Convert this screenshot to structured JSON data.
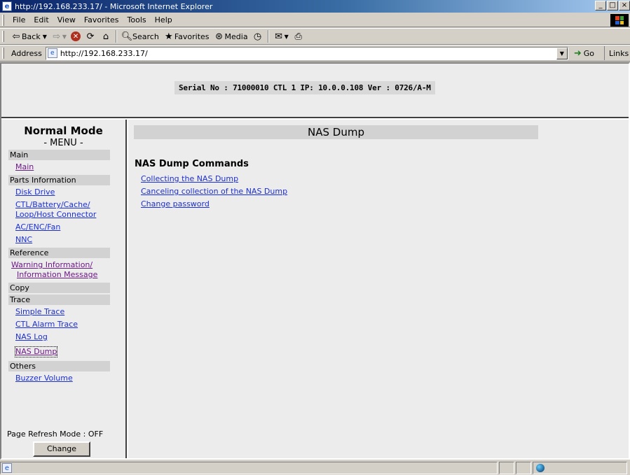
{
  "window": {
    "title": "http://192.168.233.17/ - Microsoft Internet Explorer",
    "buttons": [
      "_",
      "□",
      "×"
    ]
  },
  "menubar": {
    "items": [
      "File",
      "Edit",
      "View",
      "Favorites",
      "Tools",
      "Help"
    ]
  },
  "toolbar": {
    "back_label": "Back",
    "search_label": "Search",
    "favorites_label": "Favorites",
    "media_label": "Media"
  },
  "addressbar": {
    "label": "Address",
    "url": "http://192.168.233.17/",
    "go_label": "Go",
    "links_label": "Links"
  },
  "banner": {
    "serial_text": "Serial No : 71000010  CTL 1  IP: 10.0.0.108  Ver : 0726/A-M"
  },
  "sidebar": {
    "mode_title": "Normal Mode",
    "menu_title": "- MENU -",
    "sections": [
      {
        "title": "Main",
        "links": [
          {
            "label": "Main"
          }
        ]
      },
      {
        "title": "Parts Information",
        "links": [
          {
            "label": "Disk Drive"
          },
          {
            "line1": "CTL/Battery/Cache/",
            "line2": "Loop/Host Connector"
          },
          {
            "label": "AC/ENC/Fan"
          },
          {
            "label": "NNC"
          }
        ]
      },
      {
        "title": "Reference",
        "links": [
          {
            "line1": "Warning Information/",
            "line2": "Information Message"
          }
        ]
      },
      {
        "title": "Copy",
        "links": []
      },
      {
        "title": "Trace",
        "links": [
          {
            "label": "Simple Trace"
          },
          {
            "label": "CTL Alarm Trace"
          },
          {
            "label": "NAS Log"
          },
          {
            "label": "NAS Dump"
          }
        ]
      },
      {
        "title": "Others",
        "links": [
          {
            "label": "Buzzer Volume"
          }
        ]
      }
    ],
    "refresh_mode": "Page Refresh Mode : OFF",
    "change_button": "Change"
  },
  "main": {
    "title": "NAS Dump",
    "commands_heading": "NAS Dump Commands",
    "commands": [
      "Collecting the NAS Dump",
      "Canceling collection of the NAS Dump",
      "Change password"
    ]
  }
}
